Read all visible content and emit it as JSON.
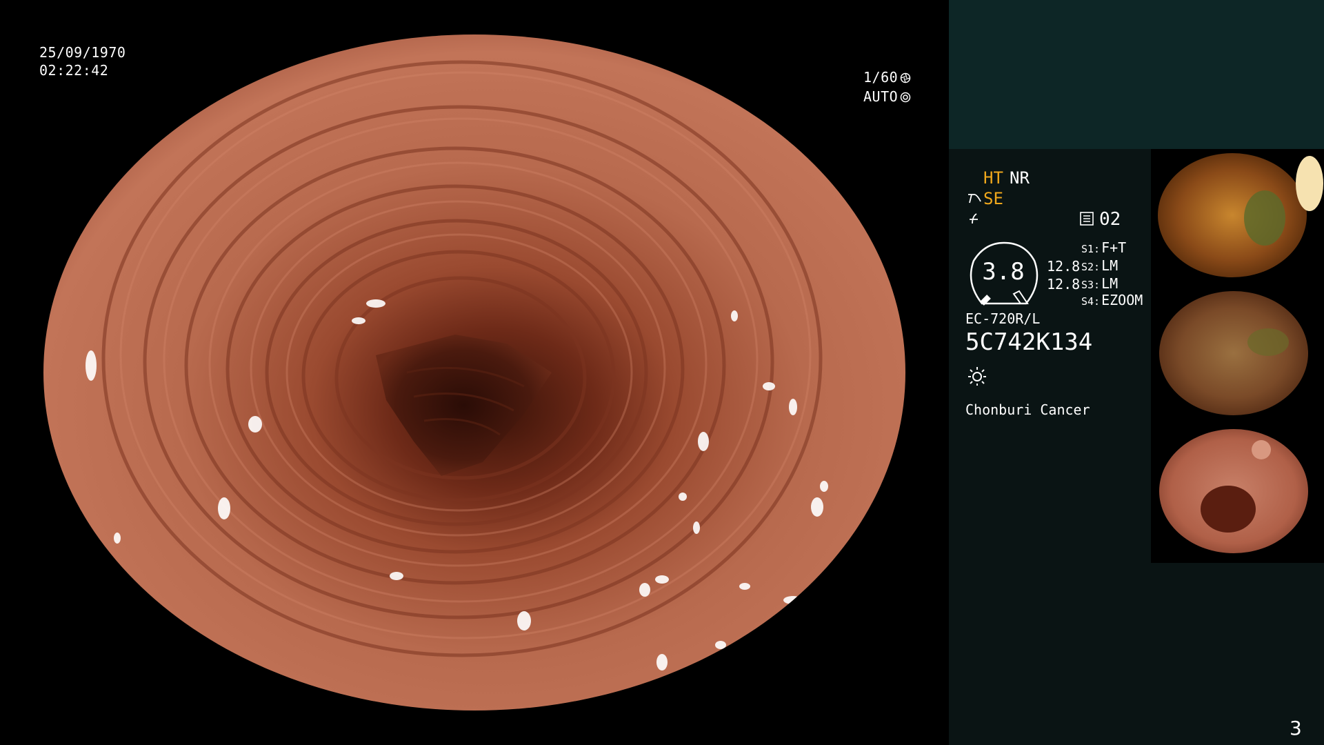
{
  "osd": {
    "date": "25/09/1970",
    "time": "02:22:42",
    "shutter": "1/60",
    "exposure": "AUTO",
    "shutter_icon": "aperture-icon",
    "exposure_icon": "auto-exposure-icon"
  },
  "panel": {
    "ht_label": "HT",
    "nr_label": "NR",
    "se_label": "SE",
    "record_number": "02",
    "gauge_value": "3.8",
    "gauge_side_top": "12.8",
    "gauge_side_bottom": "12.8",
    "switches": [
      {
        "key": "S1:",
        "value": "F+T"
      },
      {
        "key": "S2:",
        "value": "LM"
      },
      {
        "key": "S3:",
        "value": "LM"
      },
      {
        "key": "S4:",
        "value": "EZOOM"
      }
    ],
    "scope_model": "EC-720R/L",
    "scope_serial": "5C742K134",
    "hospital": "Chonburi Cancer",
    "colors": {
      "highlight": "#f0a81c",
      "text": "#ffffff",
      "panel_top": "#0d2626",
      "panel_body": "#0a1414"
    }
  },
  "page_number": "3"
}
